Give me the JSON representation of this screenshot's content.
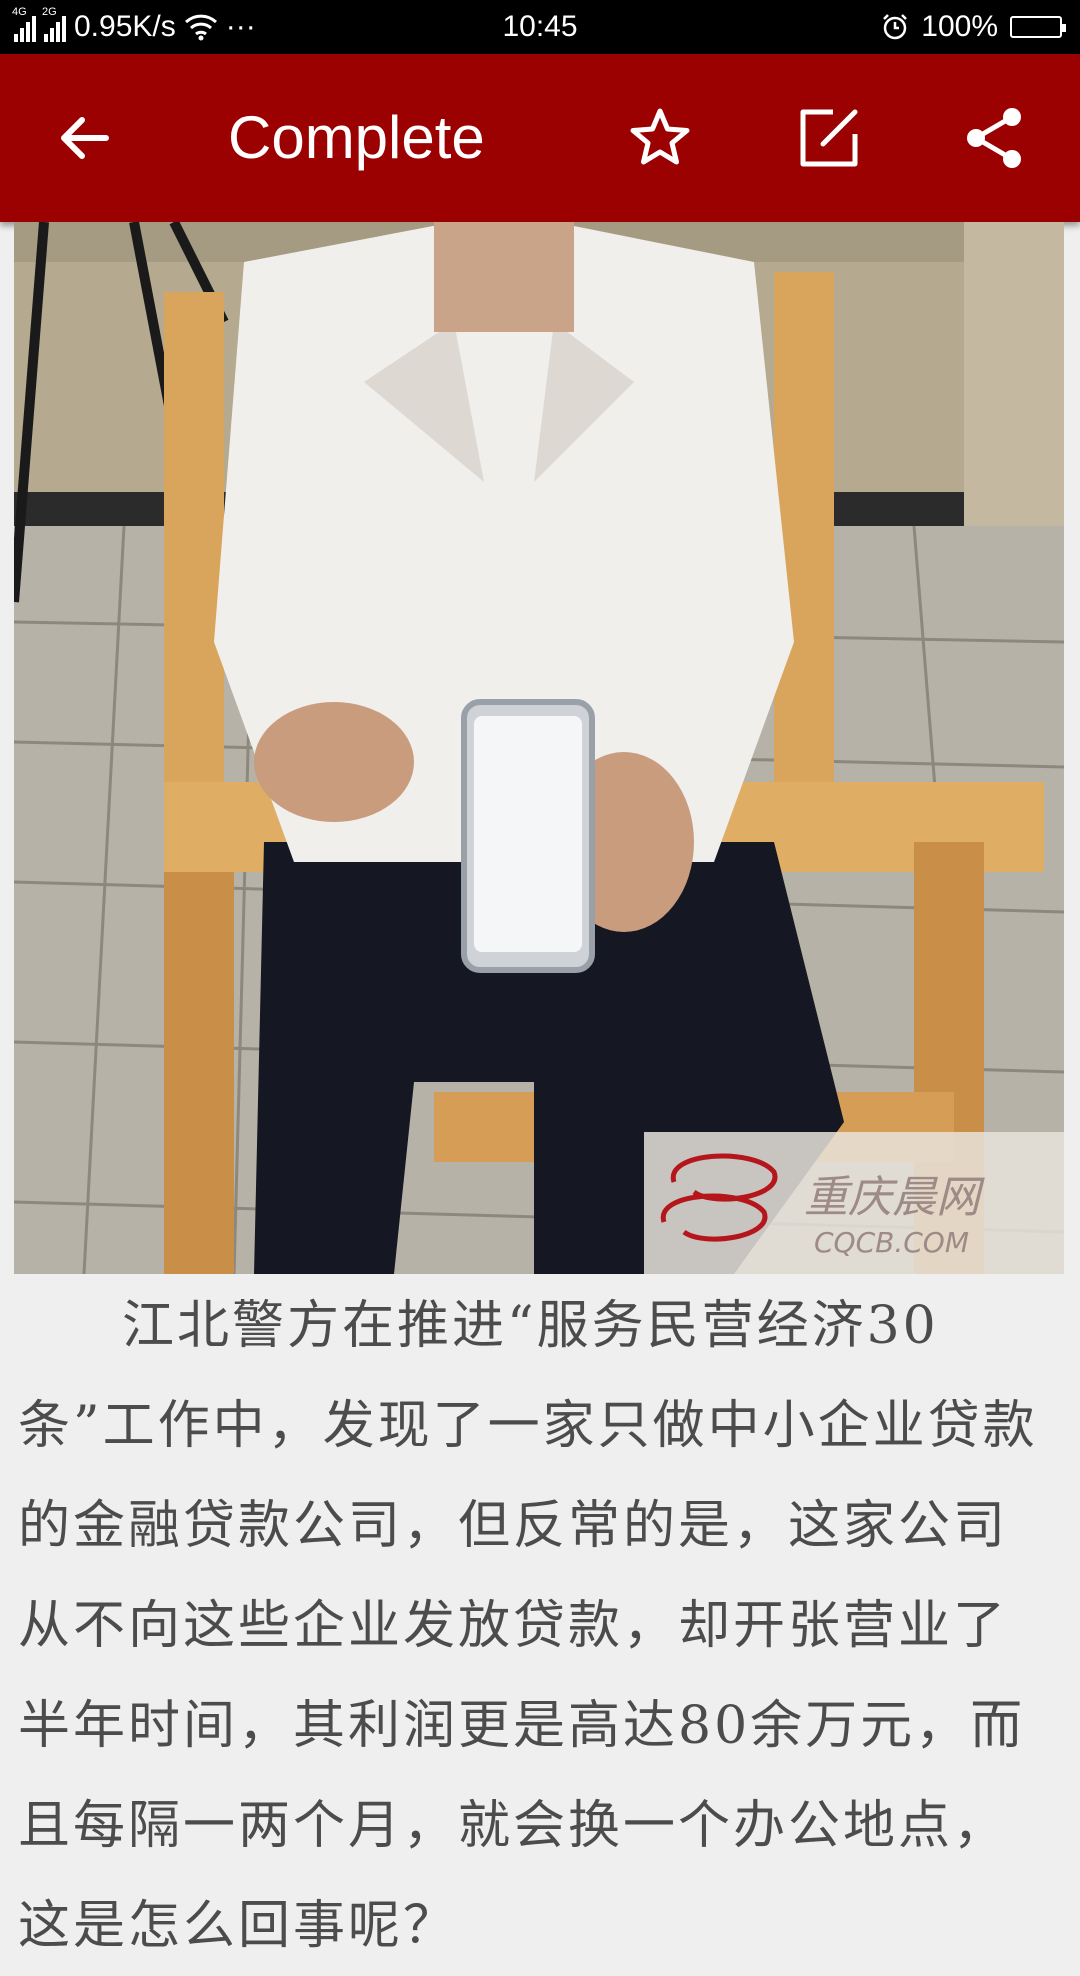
{
  "status_bar": {
    "network_speed": "0.95K/s",
    "sim1_tag": "4G",
    "sim2_tag": "2G",
    "more": "···",
    "time": "10:45",
    "battery": "100%",
    "battery_level": 1.0
  },
  "app_bar": {
    "title": "Complete",
    "icons": [
      "back-arrow-icon",
      "star-icon",
      "edit-icon",
      "share-icon"
    ],
    "color": "#9b0101"
  },
  "image": {
    "watermark_text": "重庆晨网",
    "watermark_url": "CQCB.COM"
  },
  "article": {
    "paragraph": "江北警方在推进“服务民营经济30条”工作中，发现了一家只做中小企业贷款的金融贷款公司，但反常的是，这家公司从不向这些企业发放贷款，却开张营业了半年时间，其利润更是高达80余万元，而且每隔一两个月，就会换一个办公地点，这是怎么回事呢？"
  }
}
